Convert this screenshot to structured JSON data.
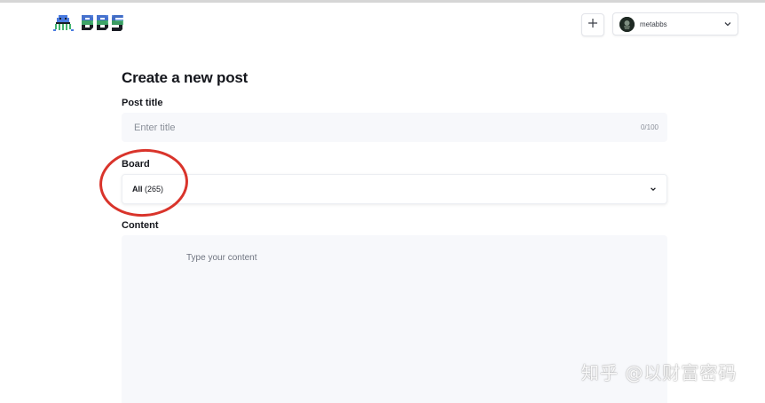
{
  "header": {
    "logo_text": "BBS",
    "user": {
      "name": "metabbs"
    }
  },
  "form": {
    "heading": "Create a new post",
    "title_field": {
      "label": "Post title",
      "placeholder": "Enter title",
      "counter": "0/100"
    },
    "board_field": {
      "label": "Board",
      "selected_name": "All",
      "selected_count": "(265)"
    },
    "content_field": {
      "label": "Content",
      "placeholder": "Type your content"
    }
  },
  "annotation": {
    "color": "#d9342b"
  },
  "watermark": "知乎 @以财富密码",
  "colors": {
    "input_bg": "#f7f8fb",
    "logo_green": "#43b36f",
    "logo_blue": "#4a7be0",
    "logo_dark": "#1a1d24"
  },
  "icons": {
    "logo": "octopus-logo-icon",
    "add": "plus-icon",
    "user_menu": "chevron-down-icon",
    "board_select": "chevron-down-icon"
  }
}
